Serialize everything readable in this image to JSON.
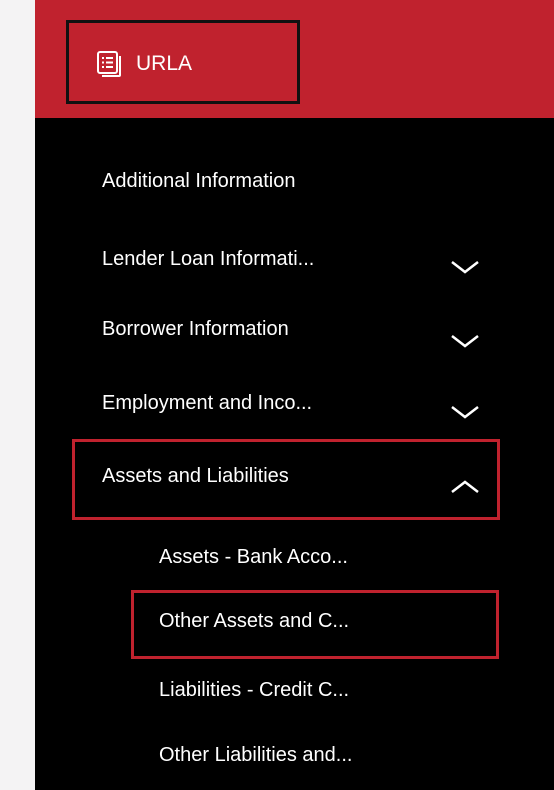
{
  "header": {
    "title": "URLA",
    "icon": "document-list-icon",
    "background_color": "#c0222e"
  },
  "nav": {
    "background_color": "#000000",
    "highlight_color": "#c0222e",
    "items": [
      {
        "label": "Additional Information"
      },
      {
        "label": "Lender Loan Informati...",
        "chevron": "chevron-down-icon"
      },
      {
        "label": "Borrower Information",
        "chevron": "chevron-down-icon"
      },
      {
        "label": "Employment and Inco...",
        "chevron": "chevron-down-icon"
      },
      {
        "label": "Assets and Liabilities",
        "chevron": "chevron-up-icon",
        "expanded": true,
        "highlighted": true,
        "children": [
          {
            "label": "Assets - Bank Acco..."
          },
          {
            "label": "Other Assets and C...",
            "highlighted": true
          },
          {
            "label": "Liabilities - Credit C..."
          },
          {
            "label": "Other Liabilities and..."
          }
        ]
      }
    ]
  }
}
